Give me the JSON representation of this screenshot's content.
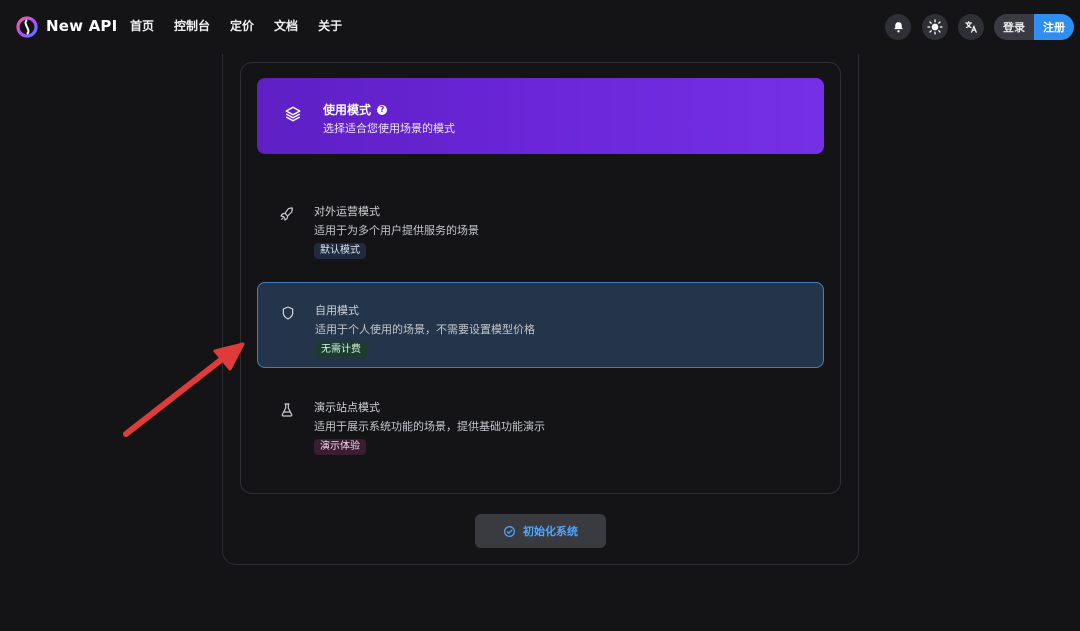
{
  "header": {
    "brand": "New API",
    "nav": [
      "首页",
      "控制台",
      "定价",
      "文档",
      "关于"
    ],
    "icons": [
      "bell-icon",
      "sun-icon",
      "translate-icon"
    ],
    "login_label": "登录",
    "register_label": "注册",
    "accent": "#2f8ef0"
  },
  "mode_header": {
    "title": "使用模式",
    "help": "?",
    "subtitle": "选择适合您使用场景的模式",
    "icon": "layers-icon",
    "color": "#6a26d8"
  },
  "options": [
    {
      "title": "对外运营模式",
      "desc": "适用于为多个用户提供服务的场景",
      "tag": "默认模式",
      "icon": "rocket-icon",
      "selected": false
    },
    {
      "title": "自用模式",
      "desc": "适用于个人使用的场景，不需要设置模型价格",
      "tag": "无需计费",
      "icon": "shield-icon",
      "selected": true
    },
    {
      "title": "演示站点模式",
      "desc": "适用于展示系统功能的场景，提供基础功能演示",
      "tag": "演示体验",
      "icon": "flask-icon",
      "selected": false
    }
  ],
  "init_button": {
    "label": "初始化系统",
    "icon": "check-circle-icon"
  },
  "annotation": {
    "icon": "red-arrow-icon",
    "color": "#e03b3b"
  }
}
